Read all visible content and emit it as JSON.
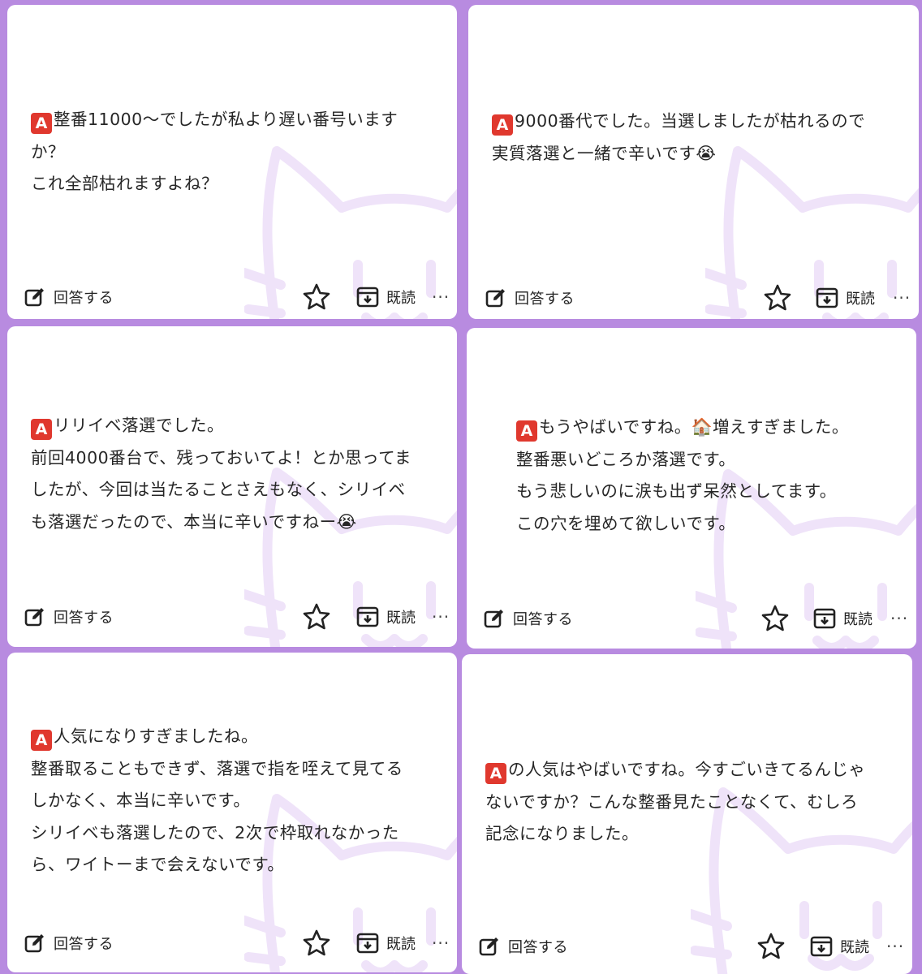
{
  "accent_color": "#b88be0",
  "badge": {
    "letter": "A",
    "color": "#e0382e"
  },
  "actions": {
    "reply_label": "回答する",
    "archive_label": "既読",
    "more_label": "···",
    "reply_icon": "pencil-square-icon",
    "favorite_icon": "star-outline-icon",
    "archive_icon": "archive-box-icon",
    "more_icon": "ellipsis-icon"
  },
  "cards": [
    {
      "lines": [
        "整番11000〜でしたが私より遅い番号います",
        "か？",
        "これ全部枯れますよね？"
      ]
    },
    {
      "lines": [
        "9000番代でした。当選しましたが枯れるので",
        "実質落選と一緒で辛いです"
      ],
      "emoji": "😭"
    },
    {
      "lines": [
        "リリイベ落選でした。",
        "前回4000番台で、残っておいてよ！とか思ってま",
        "したが、今回は当たることさえもなく、シリイベ",
        "も落選だったので、本当に辛いですねー"
      ],
      "emoji": "😭"
    },
    {
      "lines": [
        "もうやばいですね。",
        "増えすぎました。",
        "整番悪いどころか落選です。",
        "もう悲しいのに涙も出ず呆然としてます。",
        "この穴を埋めて欲しいです。"
      ],
      "emoji": "🏠"
    },
    {
      "lines": [
        "人気になりすぎましたね。",
        "整番取ることもできず、落選で指を咥えて見てる",
        "しかなく、本当に辛いです。",
        "シリイベも落選したので、2次で枠取れなかった",
        "ら、ワイトーまで会えないです。"
      ]
    },
    {
      "lines": [
        "の人気はやばいですね。今すごいきてるんじゃ",
        "ないですか？こんな整番見たことなくて、むしろ",
        "記念になりました。"
      ]
    }
  ]
}
